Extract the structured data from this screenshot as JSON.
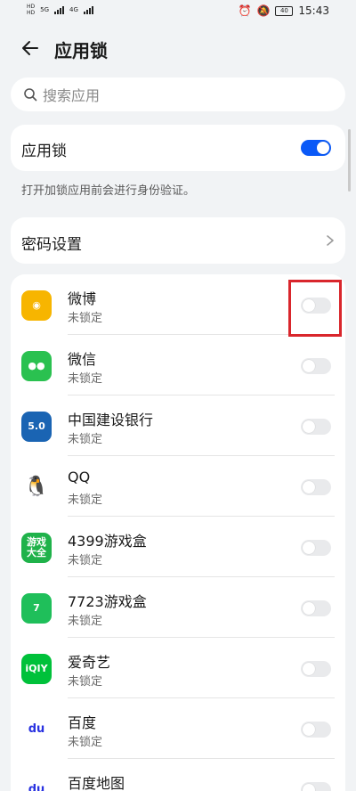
{
  "status_bar": {
    "sim1": "HD",
    "sim2": "HD",
    "net1": "5G",
    "net2": "4G",
    "battery": "40",
    "time": "15:43"
  },
  "header": {
    "title": "应用锁"
  },
  "search": {
    "placeholder": "搜索应用"
  },
  "applock": {
    "label": "应用锁",
    "enabled": true,
    "hint": "打开加锁应用前会进行身份验证。"
  },
  "password": {
    "label": "密码设置"
  },
  "apps": [
    {
      "name": "微博",
      "status": "未锁定",
      "icon": "weibo-icon",
      "color": "#f7b500",
      "glyph": "◉"
    },
    {
      "name": "微信",
      "status": "未锁定",
      "icon": "wechat-icon",
      "color": "#2ac150",
      "glyph": "●●"
    },
    {
      "name": "中国建设银行",
      "status": "未锁定",
      "icon": "ccb-icon",
      "color": "#1a64b3",
      "glyph": "5.0"
    },
    {
      "name": "QQ",
      "status": "未锁定",
      "icon": "qq-icon",
      "color": "#ffffff",
      "glyph": "🐧"
    },
    {
      "name": "4399游戏盒",
      "status": "未锁定",
      "icon": "4399-icon",
      "color": "#1fb24a",
      "glyph": "游戏\n大全"
    },
    {
      "name": "7723游戏盒",
      "status": "未锁定",
      "icon": "7723-icon",
      "color": "#1fbf5a",
      "glyph": "7"
    },
    {
      "name": "爱奇艺",
      "status": "未锁定",
      "icon": "iqiyi-icon",
      "color": "#00c13a",
      "glyph": "iQIY"
    },
    {
      "name": "百度",
      "status": "未锁定",
      "icon": "baidu-icon",
      "color": "#ffffff",
      "glyph": "du"
    },
    {
      "name": "百度地图",
      "status": "",
      "icon": "baidu-map-icon",
      "color": "#ffffff",
      "glyph": "du"
    }
  ]
}
